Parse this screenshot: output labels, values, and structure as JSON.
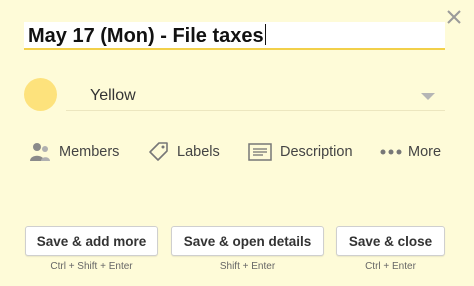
{
  "title_input": {
    "value": "May 17 (Mon) - File taxes"
  },
  "color": {
    "label": "Yellow",
    "swatch": "#fde27c"
  },
  "actions": {
    "members": {
      "label": "Members",
      "icon": "members-icon"
    },
    "labels": {
      "label": "Labels",
      "icon": "tag-icon"
    },
    "description": {
      "label": "Description",
      "icon": "description-icon"
    },
    "more": {
      "label": "More",
      "icon": "more-dots-icon"
    }
  },
  "buttons": {
    "add_more": {
      "label": "Save & add more",
      "shortcut": "Ctrl + Shift + Enter"
    },
    "open_details": {
      "label": "Save & open details",
      "shortcut": "Shift + Enter"
    },
    "close": {
      "label": "Save & close",
      "shortcut": "Ctrl + Enter"
    }
  },
  "colors": {
    "background": "#fefbd8",
    "accent_underline": "#f2d04a"
  }
}
